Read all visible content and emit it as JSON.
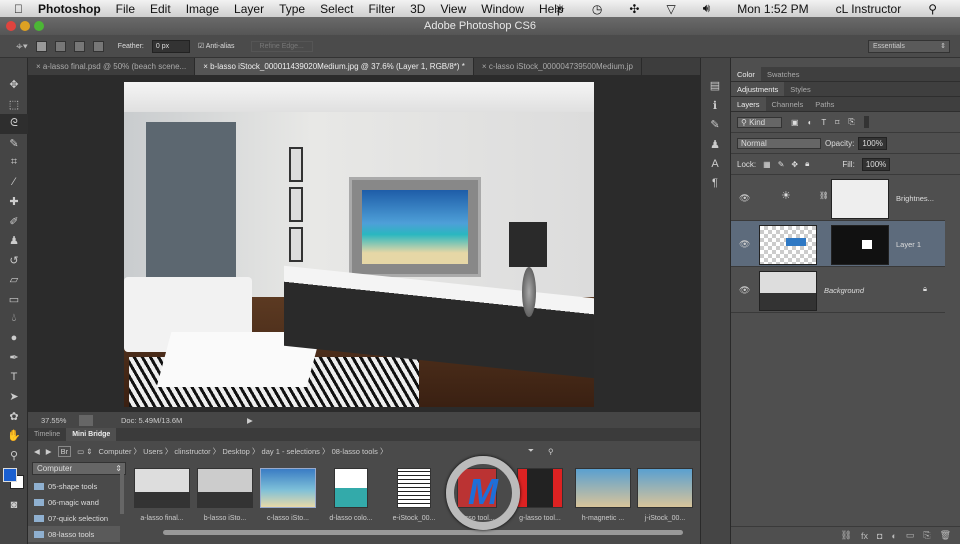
{
  "menubar": {
    "app": "Photoshop",
    "items": [
      "File",
      "Edit",
      "Image",
      "Layer",
      "Type",
      "Select",
      "Filter",
      "3D",
      "View",
      "Window",
      "Help"
    ],
    "clock": "Mon 1:52 PM",
    "user": "cL Instructor"
  },
  "window": {
    "title": "Adobe Photoshop CS6"
  },
  "options": {
    "feather_label": "Feather:",
    "feather_value": "0 px",
    "antialias_label": "Anti-alias",
    "antialias_checked": true,
    "refine_edge": "Refine Edge...",
    "workspace": "Essentials"
  },
  "tabs": [
    {
      "label": "a-lasso final.psd @ 50% (beach scene...",
      "active": false
    },
    {
      "label": "b-lasso iStock_000011439020Medium.jpg @ 37.6% (Layer 1, RGB/8*) *",
      "active": true
    },
    {
      "label": "c-lasso iStock_000004739500Medium.jp",
      "active": false
    }
  ],
  "status": {
    "zoom": "37.55%",
    "doc": "Doc: 5.49M/13.6M"
  },
  "bridge": {
    "tabs": [
      "Timeline",
      "Mini Bridge"
    ],
    "active_tab": "Mini Bridge",
    "breadcrumb": [
      "Computer",
      "Users",
      "clinstructor",
      "Desktop",
      "day 1 - selections",
      "08-lasso tools"
    ],
    "location": "Computer",
    "folders": [
      "05-shape tools",
      "06-magic wand",
      "07-quick selection",
      "08-lasso tools"
    ],
    "selected_folder": "08-lasso tools",
    "thumbnails": [
      "a-lasso final...",
      "b-lasso iSto...",
      "c-lasso iSto...",
      "d-lasso colo...",
      "e-iStock_00...",
      "lasso tool...",
      "g-lasso tool...",
      "h-magnetic ...",
      "j-iStock_00..."
    ]
  },
  "panels": {
    "group1": [
      "Color",
      "Swatches"
    ],
    "group2": [
      "Adjustments",
      "Styles"
    ],
    "group3": [
      "Layers",
      "Channels",
      "Paths"
    ],
    "filter_kind": "Kind",
    "blend_mode": "Normal",
    "opacity_label": "Opacity:",
    "opacity": "100%",
    "lock_label": "Lock:",
    "fill_label": "Fill:",
    "fill": "100%",
    "layers": [
      {
        "name": "Brightnes...",
        "type": "adjustment"
      },
      {
        "name": "Layer 1",
        "selected": true
      },
      {
        "name": "Background",
        "locked": true
      }
    ]
  },
  "colors": {
    "foreground": "#1a5fd0",
    "background": "#ffffff",
    "accent_selected_layer": "#5d6b7c"
  }
}
